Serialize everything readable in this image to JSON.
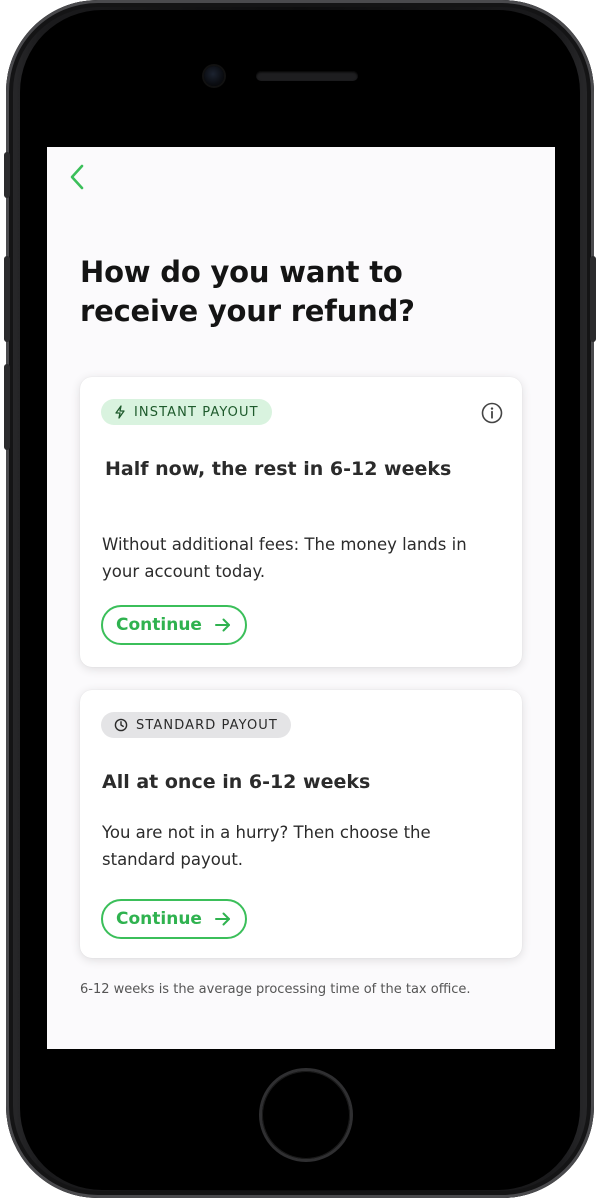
{
  "screen": {
    "back_icon": "chevron-left-icon",
    "title": "How do you want to receive your refund?",
    "accent_color": "#3bbf5a"
  },
  "options": [
    {
      "badge_icon": "lightning-icon",
      "badge_label": "INSTANT PAYOUT",
      "badge_color": "#d9f3df",
      "info_icon": "info-icon",
      "heading": "Half now, the rest in 6-12 weeks",
      "description": "Without additional fees: The money lands in your account today.",
      "button_label": "Continue",
      "button_icon": "arrow-right-icon"
    },
    {
      "badge_icon": "clock-icon",
      "badge_label": "STANDARD PAYOUT",
      "badge_color": "#e4e4e6",
      "heading": "All at once in 6-12 weeks",
      "description": "You are not in a hurry? Then choose the standard payout.",
      "button_label": "Continue",
      "button_icon": "arrow-right-icon"
    }
  ],
  "footnote": "6-12 weeks is the average processing time of the tax office."
}
